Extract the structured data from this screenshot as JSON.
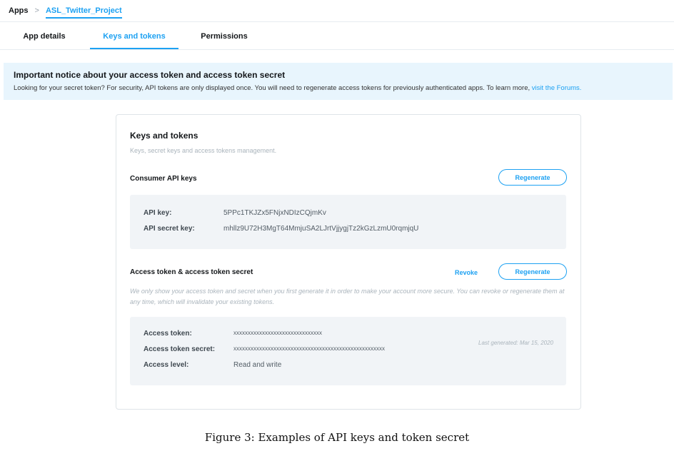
{
  "breadcrumb": {
    "root": "Apps",
    "separator": ">",
    "current": "ASL_Twitter_Project"
  },
  "tabs": [
    {
      "label": "App details",
      "active": false
    },
    {
      "label": "Keys and tokens",
      "active": true
    },
    {
      "label": "Permissions",
      "active": false
    }
  ],
  "notice": {
    "title": "Important notice about your access token and access token secret",
    "body": "Looking for your secret token? For security, API tokens are only displayed once. You will need to regenerate access tokens for previously authenticated apps. To learn more,",
    "link": "visit the Forums."
  },
  "card": {
    "title": "Keys and tokens",
    "subtitle": "Keys, secret keys and access tokens management.",
    "consumer": {
      "title": "Consumer API keys",
      "regenerate_label": "Regenerate",
      "api_key_label": "API key:",
      "api_key_value": "5PPc1TKJZx5FNjxNDIzCQjmKv",
      "api_secret_label": "API secret key:",
      "api_secret_value": "mhllz9U72H3MgT64MmjuSA2LJrtVjjygjTz2kGzLzmU0rqmjqU"
    },
    "access": {
      "title": "Access token & access token secret",
      "revoke_label": "Revoke",
      "regenerate_label": "Regenerate",
      "note": "We only show your access token and secret when you first generate it in order to make your account more secure. You can revoke or regenerate them at any time, which will invalidate your existing tokens.",
      "token_label": "Access token:",
      "token_value": "xxxxxxxxxxxxxxxxxxxxxxxxxxxxxxx",
      "secret_label": "Access token secret:",
      "secret_value": "xxxxxxxxxxxxxxxxxxxxxxxxxxxxxxxxxxxxxxxxxxxxxxxxxxxxx",
      "level_label": "Access level:",
      "level_value": "Read and write",
      "last_generated": "Last generated: Mar 15, 2020"
    }
  },
  "caption": "Figure 3: Examples of API keys and token secret",
  "colors": {
    "accent": "#1da1f2",
    "notice_bg": "#e8f5fd",
    "panel_bg": "#f1f4f7"
  }
}
